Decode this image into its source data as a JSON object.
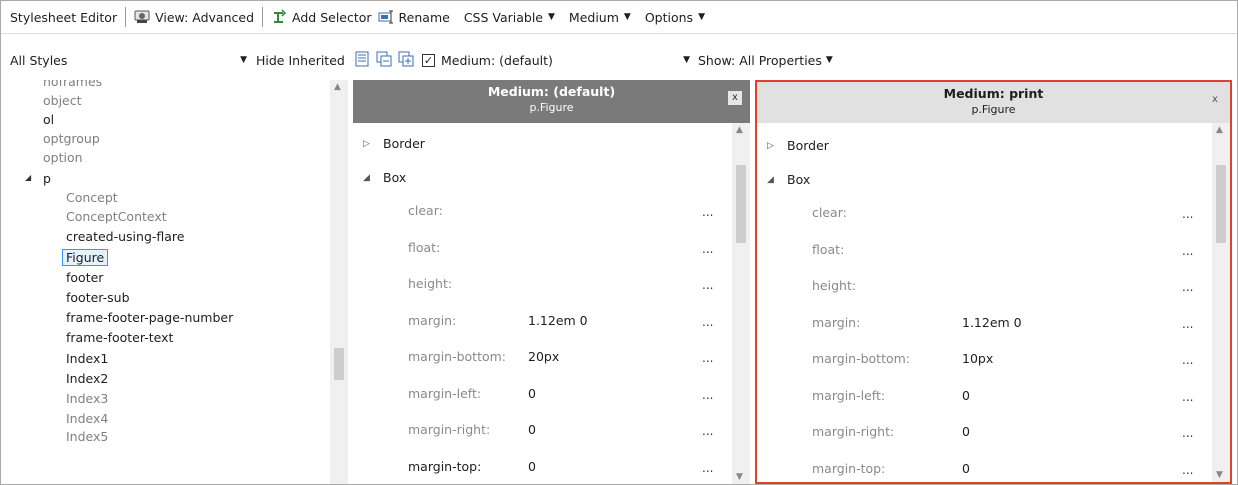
{
  "toolbar": {
    "title": "Stylesheet Editor",
    "view": "View: Advanced",
    "add_selector": "Add Selector",
    "rename": "Rename",
    "css_variable": "CSS Variable",
    "medium": "Medium",
    "options": "Options"
  },
  "filterbar": {
    "styles_combo": "All Styles",
    "hide_inherited": "Hide Inherited",
    "medium_checkbox": "Medium: (default)",
    "show_props": "Show: All Properties"
  },
  "tree": {
    "items": [
      {
        "label": "noframes",
        "grey": true,
        "indent": 1
      },
      {
        "label": "object",
        "grey": true,
        "indent": 1
      },
      {
        "label": "ol",
        "grey": false,
        "indent": 1
      },
      {
        "label": "optgroup",
        "grey": true,
        "indent": 1
      },
      {
        "label": "option",
        "grey": true,
        "indent": 1
      },
      {
        "label": "p",
        "grey": false,
        "indent": 0,
        "expanded": true
      },
      {
        "label": "Concept",
        "grey": true,
        "indent": 2
      },
      {
        "label": "ConceptContext",
        "grey": true,
        "indent": 2
      },
      {
        "label": "created-using-flare",
        "grey": false,
        "indent": 2
      },
      {
        "label": "Figure",
        "grey": false,
        "indent": 2,
        "selected": true
      },
      {
        "label": "footer",
        "grey": false,
        "indent": 2
      },
      {
        "label": "footer-sub",
        "grey": false,
        "indent": 2
      },
      {
        "label": "frame-footer-page-number",
        "grey": false,
        "indent": 2
      },
      {
        "label": "frame-footer-text",
        "grey": false,
        "indent": 2
      },
      {
        "label": "Index1",
        "grey": false,
        "indent": 2
      },
      {
        "label": "Index2",
        "grey": false,
        "indent": 2
      },
      {
        "label": "Index3",
        "grey": true,
        "indent": 2
      },
      {
        "label": "Index4",
        "grey": true,
        "indent": 2
      },
      {
        "label": "Index5",
        "grey": true,
        "indent": 2
      }
    ]
  },
  "panels": [
    {
      "medium": "Medium: (default)",
      "selector": "p.Figure",
      "close": "x",
      "sections": [
        "Border",
        "Box"
      ],
      "props": [
        {
          "name": "clear:",
          "value": ""
        },
        {
          "name": "float:",
          "value": ""
        },
        {
          "name": "height:",
          "value": ""
        },
        {
          "name": "margin:",
          "value": "1.12em 0"
        },
        {
          "name": "margin-bottom:",
          "value": "20px"
        },
        {
          "name": "margin-left:",
          "value": "0"
        },
        {
          "name": "margin-right:",
          "value": "0"
        },
        {
          "name": "margin-top:",
          "value": "0"
        }
      ]
    },
    {
      "medium": "Medium: print",
      "selector": "p.Figure",
      "close": "x",
      "sections": [
        "Border",
        "Box"
      ],
      "props": [
        {
          "name": "clear:",
          "value": ""
        },
        {
          "name": "float:",
          "value": ""
        },
        {
          "name": "height:",
          "value": ""
        },
        {
          "name": "margin:",
          "value": "1.12em 0"
        },
        {
          "name": "margin-bottom:",
          "value": "10px"
        },
        {
          "name": "margin-left:",
          "value": "0"
        },
        {
          "name": "margin-right:",
          "value": "0"
        },
        {
          "name": "margin-top:",
          "value": "0"
        }
      ]
    }
  ],
  "ellipsis": "...",
  "colors": {
    "highlight_border": "#e0412a",
    "default_header": "#7a7a7a",
    "print_header": "#e1e1e1"
  }
}
